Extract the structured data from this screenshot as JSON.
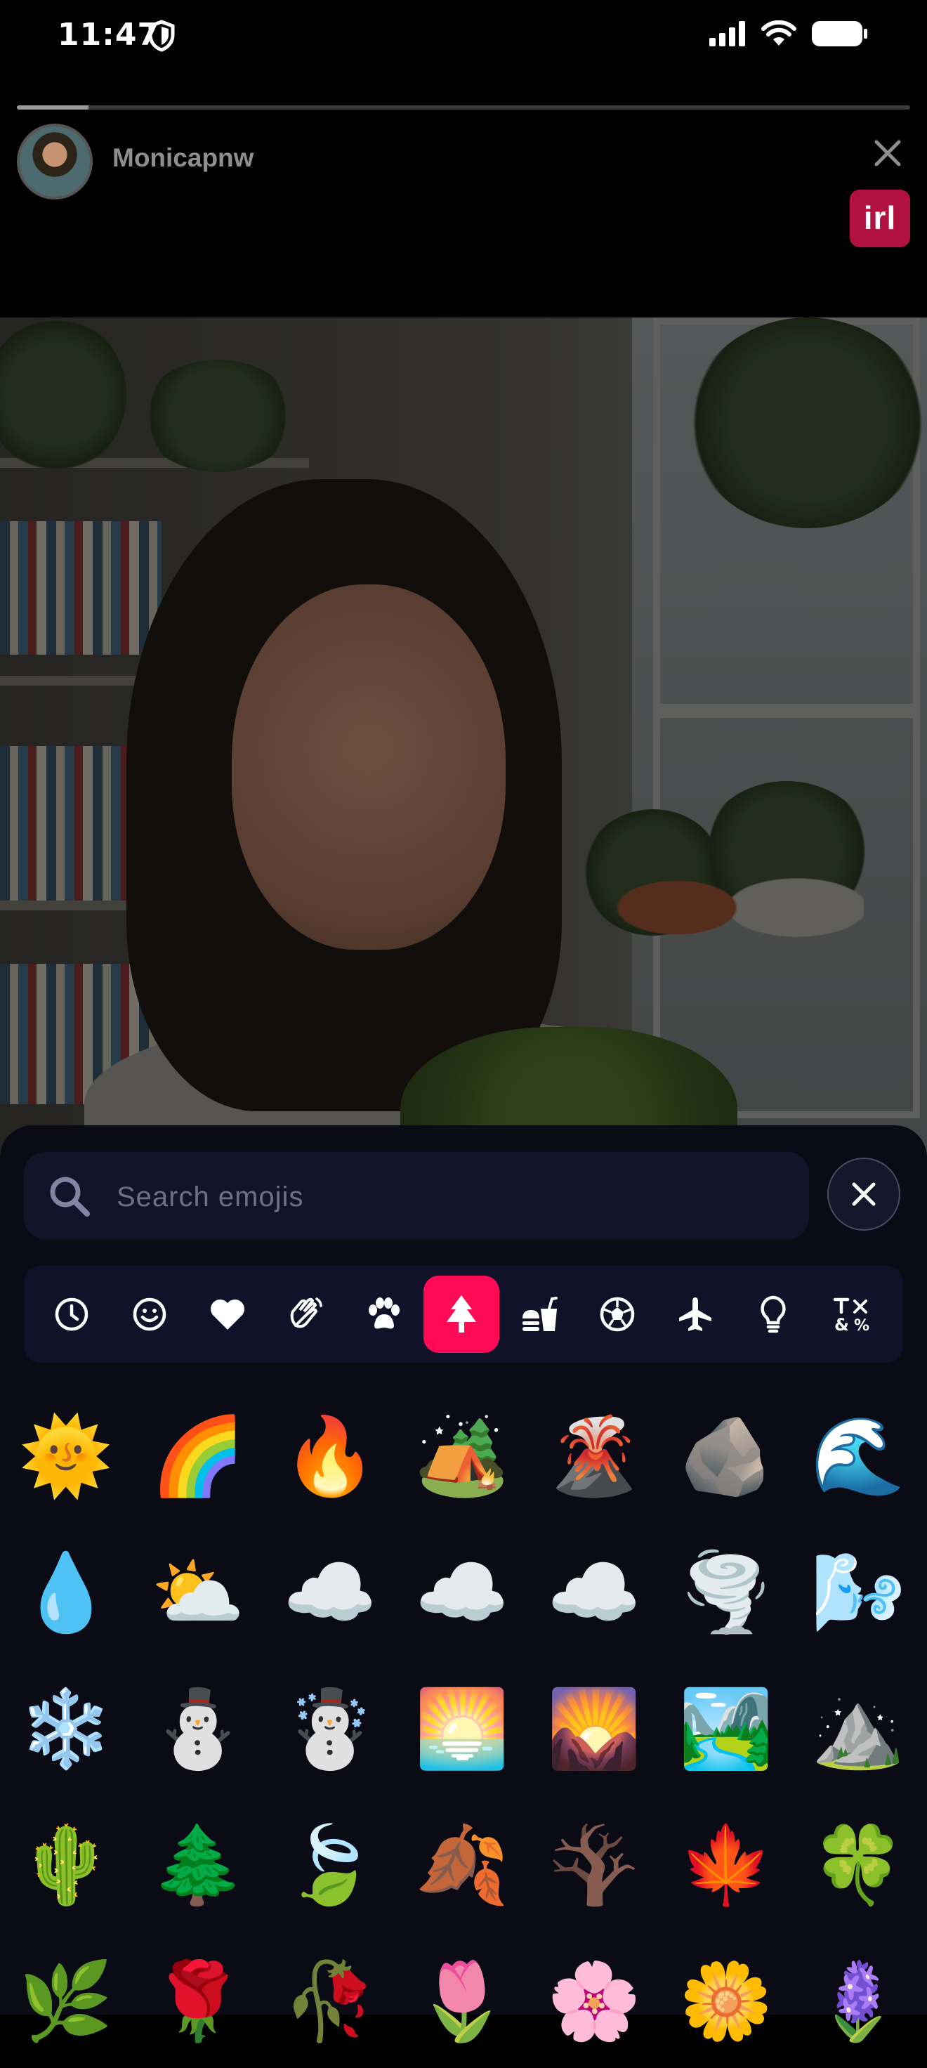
{
  "status_bar": {
    "time": "11:47"
  },
  "story": {
    "progress": 0.08,
    "username": "Monicapnw",
    "badge": "irl"
  },
  "emoji_picker": {
    "search_placeholder": "Search emojis",
    "categories": [
      {
        "icon": "clock-icon",
        "active": false
      },
      {
        "icon": "smiley-icon",
        "active": false
      },
      {
        "icon": "heart-icon",
        "active": false
      },
      {
        "icon": "waving-hand-icon",
        "active": false
      },
      {
        "icon": "paw-icon",
        "active": false
      },
      {
        "icon": "tree-icon",
        "active": true
      },
      {
        "icon": "food-icon",
        "active": false
      },
      {
        "icon": "soccer-ball-icon",
        "active": false
      },
      {
        "icon": "airplane-icon",
        "active": false
      },
      {
        "icon": "lightbulb-icon",
        "active": false
      },
      {
        "icon": "symbols-icon",
        "active": false
      }
    ],
    "accent_color": "#ff0a54",
    "emojis": [
      [
        "🌞",
        "🌈",
        "🔥",
        "🏕️",
        "🌋",
        "🪨",
        "🌊"
      ],
      [
        "💧",
        "⛅",
        "☁️",
        "☁️",
        "☁️",
        "🌪️",
        "🌬️"
      ],
      [
        "❄️",
        "⛄",
        "☃️",
        "🌅",
        "🌄",
        "🏞️",
        "⛰️"
      ],
      [
        "🌵",
        "🌲",
        "🍃",
        "🍂",
        "🪾",
        "🍁",
        "🍀"
      ],
      [
        "🌿",
        "🌹",
        "🥀",
        "🌷",
        "🌸",
        "🌼",
        "🪻"
      ]
    ]
  }
}
